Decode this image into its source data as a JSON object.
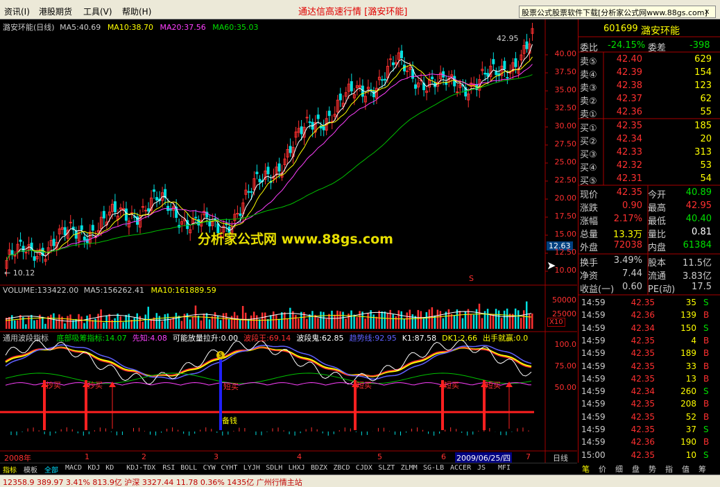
{
  "menu": {
    "items": [
      "资讯(I)",
      "港股期货",
      "工具(V)",
      "帮助(H)"
    ],
    "title": "通达信高速行情 [潞安环能]",
    "ad": "股票公式股票软件下载[分析家公式网www.88gs.com]",
    "close": "x"
  },
  "main_chart": {
    "title": "潞安环能(日线)",
    "ma5": "MA5:40.69",
    "ma10": "MA10:38.70",
    "ma20": "MA20:37.56",
    "ma60": "MA60:35.03",
    "high_label": "42.95",
    "low_label": "10.12",
    "price_tag": "12.63",
    "s_mark": "S",
    "y_ticks": [
      "40.00",
      "37.50",
      "35.00",
      "32.50",
      "30.00",
      "27.50",
      "25.00",
      "22.50",
      "20.00",
      "17.50",
      "15.00",
      "12.50",
      "10.00"
    ]
  },
  "chart_data": [
    {
      "type": "line",
      "title": "潞安环能(日线)",
      "series": [
        {
          "name": "MA5"
        },
        {
          "name": "MA10"
        },
        {
          "name": "MA20"
        },
        {
          "name": "MA60"
        }
      ],
      "ylim": [
        10,
        42.95
      ]
    },
    {
      "type": "bar",
      "title": "VOLUME",
      "series": [
        {
          "name": "MA5"
        },
        {
          "name": "MA10"
        }
      ]
    }
  ],
  "volume": {
    "title": "VOLUME:133422.00",
    "ma5": "MA5:156262.41",
    "ma10": "MA10:161889.59",
    "y_ticks": [
      "50000",
      "25000"
    ],
    "unit": "X10"
  },
  "indicator": {
    "title": "通用波段指标",
    "items": [
      {
        "t": "底部吸筹指标:14.07",
        "c": "#00e000"
      },
      {
        "t": "先知:4.08",
        "c": "#ff40ff"
      },
      {
        "t": "可能放量拉升:0.00",
        "c": "#ffffff"
      },
      {
        "t": "波段王:69.14",
        "c": "#ff3030"
      },
      {
        "t": "波段鬼:62.85",
        "c": "#ffffff"
      },
      {
        "t": "趋势线:92.95",
        "c": "#6060ff"
      },
      {
        "t": "K1:87.58",
        "c": "#ffffff"
      },
      {
        "t": "DK1:2.66",
        "c": "#ffff00"
      },
      {
        "t": "出手就赢:0.0",
        "c": "#ffff00"
      }
    ],
    "y_ticks": [
      "100.0",
      "75.00",
      "50.00"
    ],
    "buy_labels": [
      "抄买",
      "抄买",
      "短买",
      "短买",
      "短买",
      "短买"
    ],
    "money_label": "备钱",
    "coin": "$"
  },
  "time_axis": {
    "labels": [
      "2008年",
      "1",
      "2",
      "3",
      "4",
      "5",
      "6",
      "2009/06/25/四",
      "7"
    ],
    "right": "日线"
  },
  "watermark": "分析家公式网 www.88gs.com",
  "quote": {
    "code": "601699",
    "name": "潞安环能",
    "weibi_l": "委比",
    "weibi": "-24.15%",
    "weicha_l": "委差",
    "weicha": "-398",
    "asks": [
      {
        "l": "卖⑤",
        "p": "42.40",
        "v": "629"
      },
      {
        "l": "卖④",
        "p": "42.39",
        "v": "154"
      },
      {
        "l": "卖③",
        "p": "42.38",
        "v": "123"
      },
      {
        "l": "卖②",
        "p": "42.37",
        "v": "62"
      },
      {
        "l": "卖①",
        "p": "42.36",
        "v": "55"
      }
    ],
    "bids": [
      {
        "l": "买①",
        "p": "42.35",
        "v": "185"
      },
      {
        "l": "买②",
        "p": "42.34",
        "v": "20"
      },
      {
        "l": "买③",
        "p": "42.33",
        "v": "313"
      },
      {
        "l": "买④",
        "p": "42.32",
        "v": "53"
      },
      {
        "l": "买⑤",
        "p": "42.31",
        "v": "54"
      }
    ],
    "stats": [
      {
        "l1": "现价",
        "v1": "42.35",
        "c1": "#ff3030",
        "l2": "今开",
        "v2": "40.89",
        "c2": "#00e000"
      },
      {
        "l1": "涨跌",
        "v1": "0.90",
        "c1": "#ff3030",
        "l2": "最高",
        "v2": "42.95",
        "c2": "#ff3030"
      },
      {
        "l1": "涨幅",
        "v1": "2.17%",
        "c1": "#ff3030",
        "l2": "最低",
        "v2": "40.40",
        "c2": "#00e000"
      },
      {
        "l1": "总量",
        "v1": "13.3万",
        "c1": "#ffff00",
        "l2": "量比",
        "v2": "0.81",
        "c2": "#ffffff"
      },
      {
        "l1": "外盘",
        "v1": "72038",
        "c1": "#ff3030",
        "l2": "内盘",
        "v2": "61384",
        "c2": "#00e000"
      }
    ],
    "fund": [
      {
        "l1": "换手",
        "v1": "3.49%",
        "l2": "股本",
        "v2": "11.5亿"
      },
      {
        "l1": "净资",
        "v1": "7.44",
        "l2": "流通",
        "v2": "3.83亿"
      },
      {
        "l1": "收益(一)",
        "v1": "0.60",
        "l2": "PE(动)",
        "v2": "17.5"
      }
    ],
    "ticks": [
      {
        "t": "14:59",
        "p": "42.35",
        "v": "35",
        "s": "S"
      },
      {
        "t": "14:59",
        "p": "42.36",
        "v": "139",
        "s": "B"
      },
      {
        "t": "14:59",
        "p": "42.34",
        "v": "150",
        "s": "S"
      },
      {
        "t": "14:59",
        "p": "42.35",
        "v": "4",
        "s": "B"
      },
      {
        "t": "14:59",
        "p": "42.35",
        "v": "189",
        "s": "B"
      },
      {
        "t": "14:59",
        "p": "42.35",
        "v": "33",
        "s": "B"
      },
      {
        "t": "14:59",
        "p": "42.35",
        "v": "13",
        "s": "B"
      },
      {
        "t": "14:59",
        "p": "42.34",
        "v": "260",
        "s": "S"
      },
      {
        "t": "14:59",
        "p": "42.35",
        "v": "208",
        "s": "B"
      },
      {
        "t": "14:59",
        "p": "42.35",
        "v": "52",
        "s": "B"
      },
      {
        "t": "14:59",
        "p": "42.35",
        "v": "37",
        "s": "S"
      },
      {
        "t": "14:59",
        "p": "42.36",
        "v": "190",
        "s": "B"
      },
      {
        "t": "15:00",
        "p": "42.35",
        "v": "10",
        "s": "S"
      }
    ]
  },
  "right_tabs": [
    "笔",
    "价",
    "细",
    "盘",
    "势",
    "指",
    "值",
    "筹"
  ],
  "bottom_tabs": [
    "指标",
    "模板",
    "全部",
    "MACD",
    "KDJ",
    "KD",
    "KDJ-TDX",
    "RSI",
    "BOLL",
    "CYW",
    "CYHT",
    "LYJH",
    "SDLH",
    "LHXJ",
    "BDZX",
    "ZBCD",
    "CJDX",
    "SLZT",
    "ZLMM",
    "SG-LB",
    "ACCER",
    "JS",
    "MFI"
  ],
  "status": "12358.9  389.97  3.41%   813.9亿 沪深 3327.44  11.78  0.36%  1435亿    广州行情主站"
}
